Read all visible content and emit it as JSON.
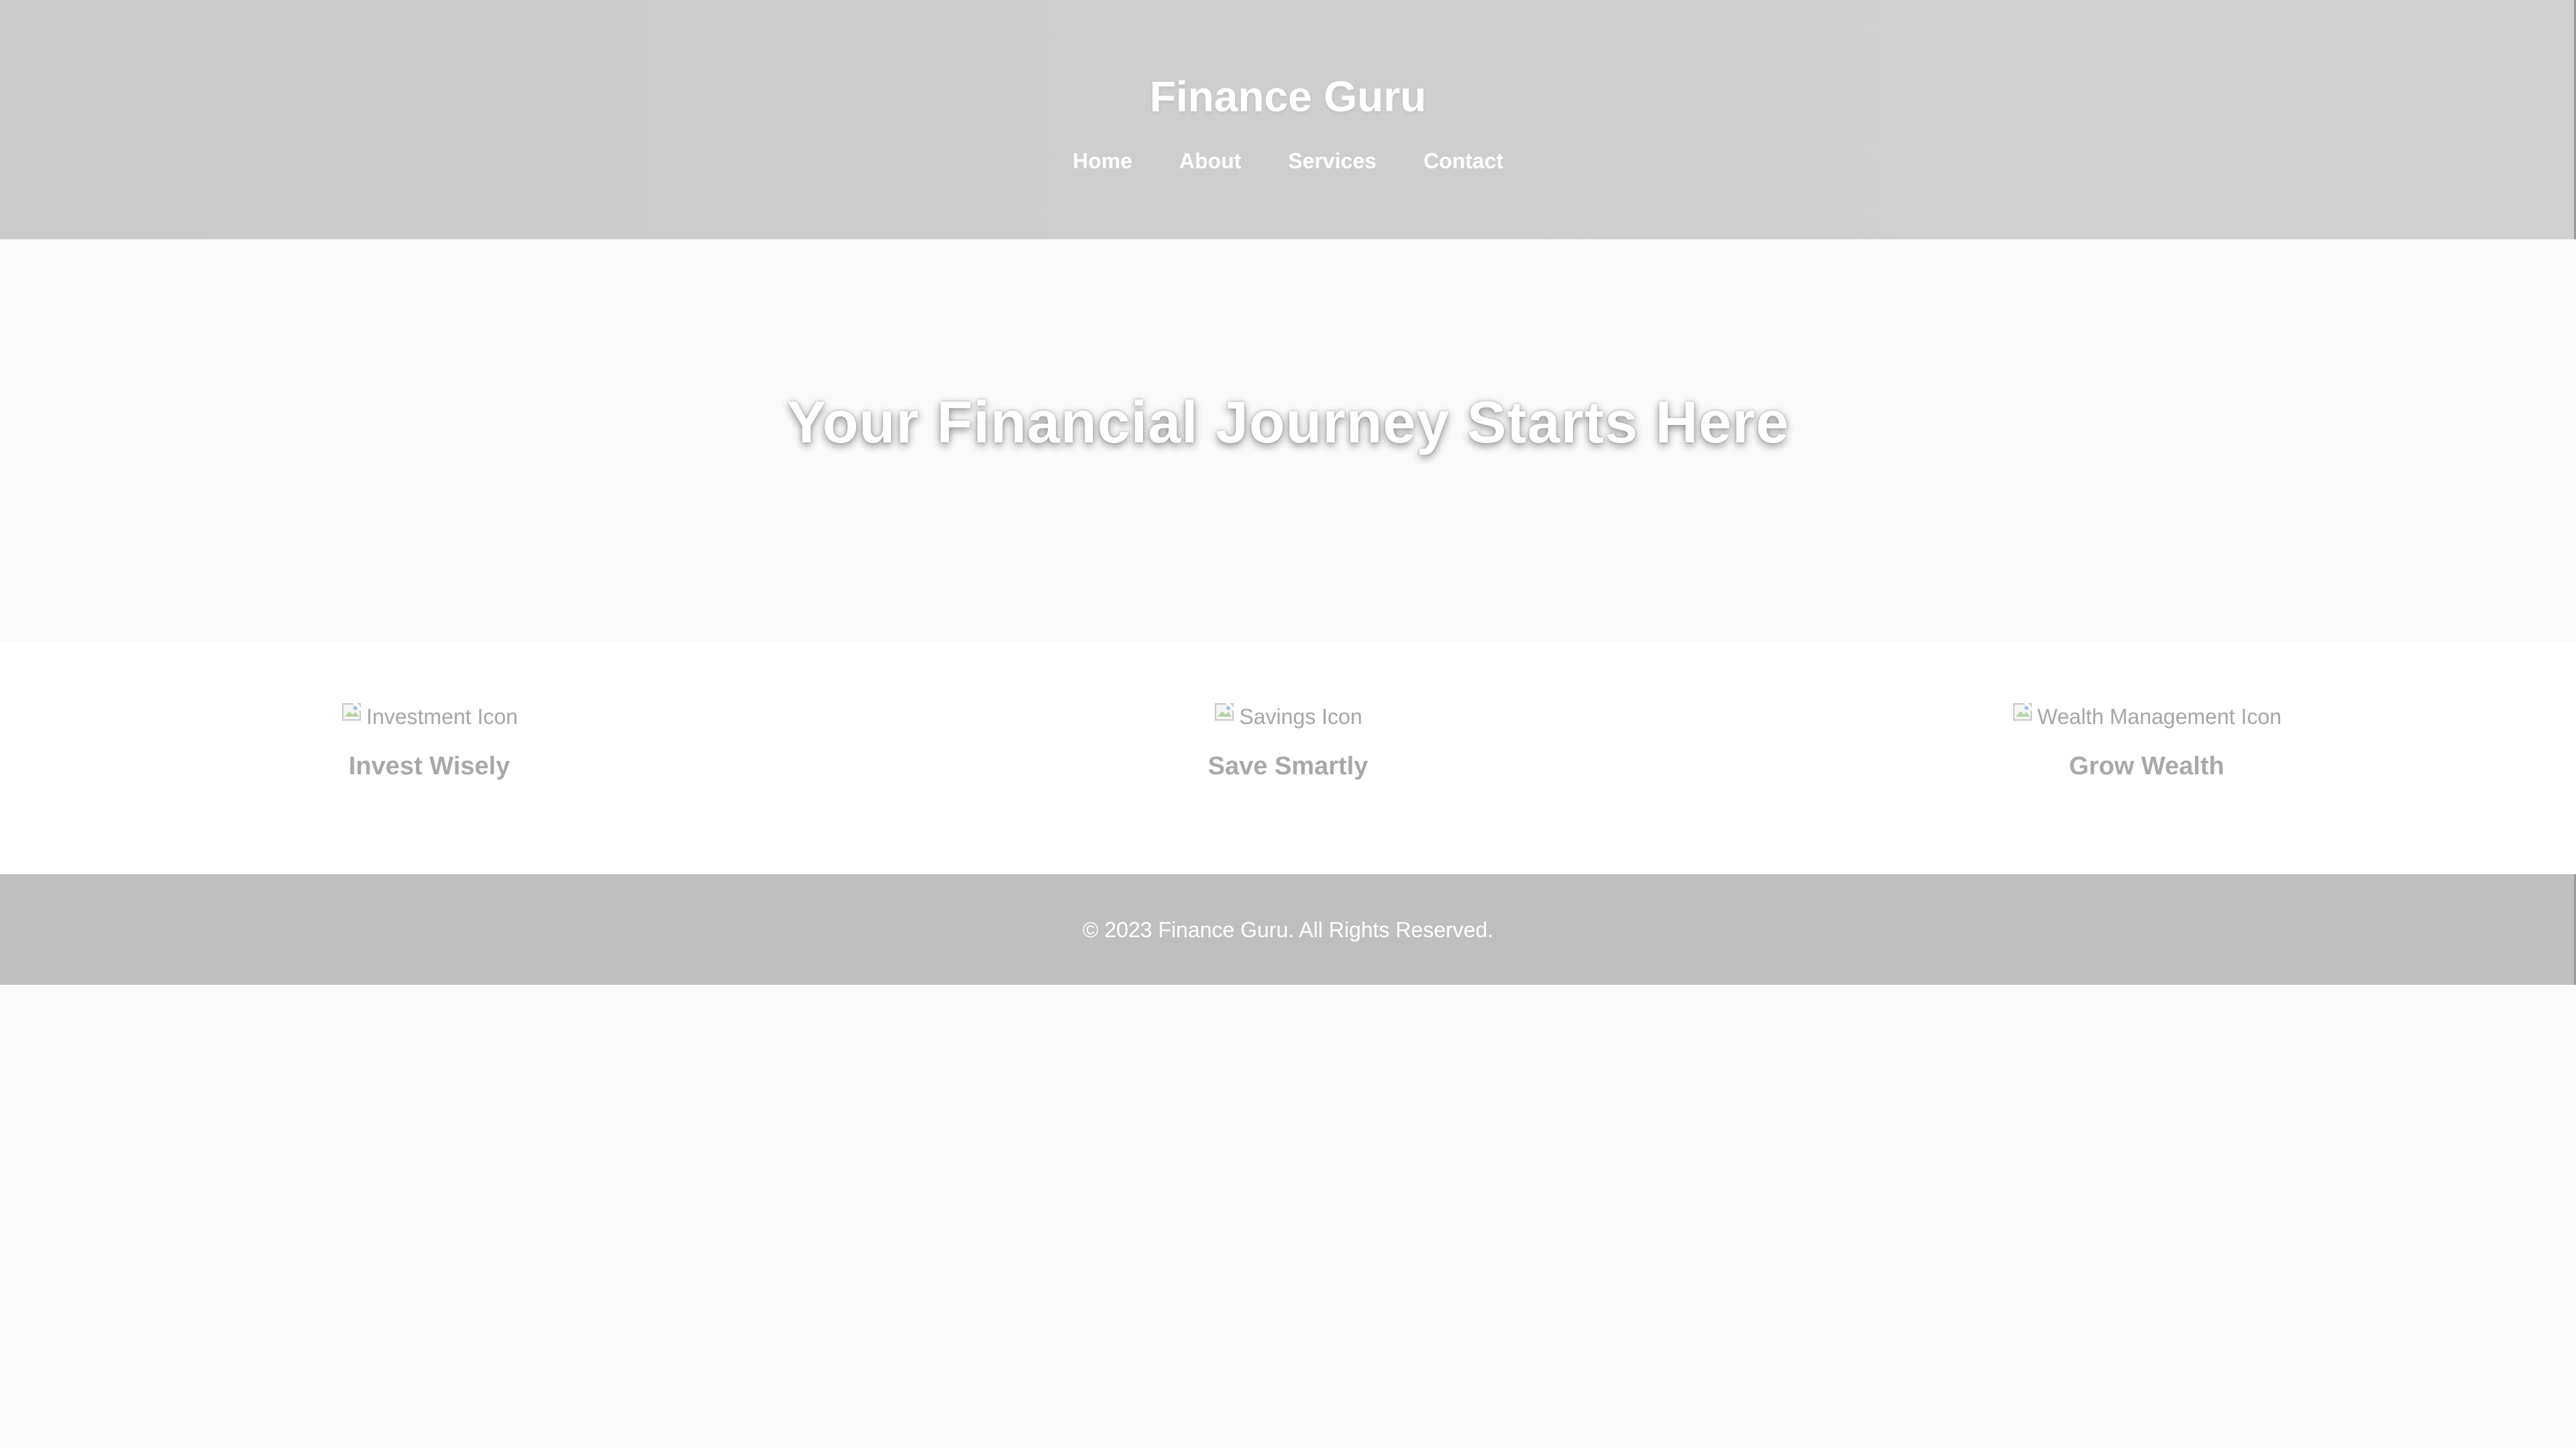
{
  "header": {
    "brand": "Finance Guru",
    "nav": [
      {
        "label": "Home",
        "icon": null
      },
      {
        "label": "About",
        "icon": null
      },
      {
        "label": "Services",
        "icon": null
      },
      {
        "label": "Contact",
        "icon": null
      }
    ]
  },
  "hero": {
    "title": "Your Financial Journey Starts Here"
  },
  "features": [
    {
      "image_alt": "Investment Icon",
      "title": "Invest Wisely",
      "icon": "broken-image-icon"
    },
    {
      "image_alt": "Savings Icon",
      "title": "Save Smartly",
      "icon": "broken-image-icon"
    },
    {
      "image_alt": "Wealth Management Icon",
      "title": "Grow Wealth",
      "icon": "broken-image-icon"
    }
  ],
  "footer": {
    "copyright": "© 2023 Finance Guru. All Rights Reserved."
  },
  "colors": {
    "header_bg": "#cecece",
    "hero_bg": "#fafafa",
    "features_bg": "#ffffff",
    "footer_bg": "#bfbfbf",
    "text_light": "#ffffff",
    "text_muted": "#a8a8a8"
  }
}
